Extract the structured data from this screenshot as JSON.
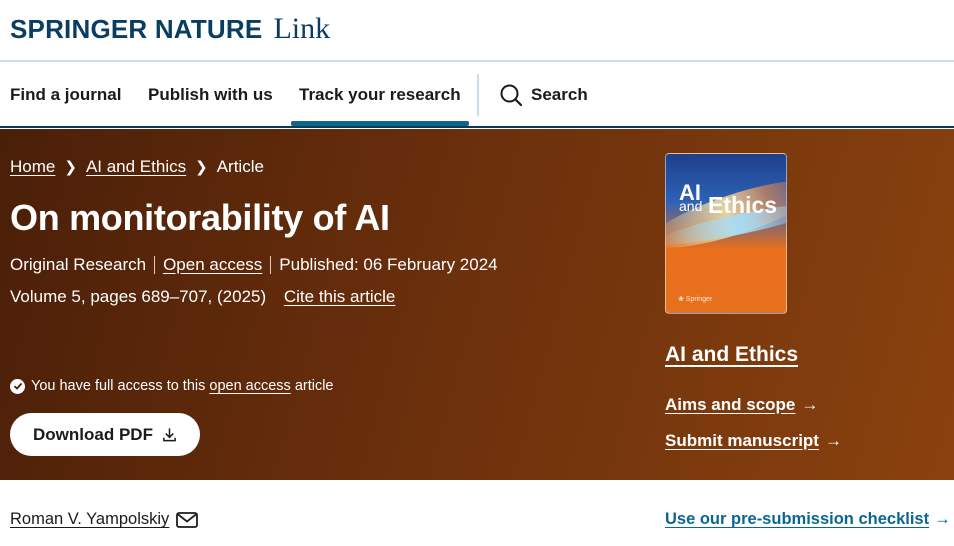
{
  "brand": {
    "main": "SPRINGER NATURE",
    "link": "Link"
  },
  "nav": {
    "items": [
      {
        "label": "Find a journal"
      },
      {
        "label": "Publish with us"
      },
      {
        "label": "Track your research"
      }
    ],
    "search_label": "Search"
  },
  "breadcrumb": {
    "home": "Home",
    "journal": "AI and Ethics",
    "current": "Article"
  },
  "article": {
    "title": "On monitorability of AI",
    "type": "Original Research",
    "access": "Open access",
    "published": "Published: 06 February 2024",
    "volume": "Volume 5, pages 689–707, (2025)",
    "cite": "Cite this article",
    "access_notice_pre": "You have full access to this",
    "access_notice_link": "open access",
    "access_notice_post": "article",
    "download": "Download PDF"
  },
  "journal": {
    "cover_line1": "AI",
    "cover_line2": "and",
    "cover_line3": "Ethics",
    "cover_publisher": "❀ Springer",
    "name": "AI and Ethics",
    "aims": "Aims and scope",
    "submit": "Submit manuscript"
  },
  "author": {
    "name": "Roman V. Yampolskiy"
  },
  "checklist": "Use our pre-submission checklist",
  "colors": {
    "hero_start": "#4a1f08",
    "hero_end": "#8a420e",
    "brand": "#0a3d62",
    "link_blue": "#0b6691"
  }
}
